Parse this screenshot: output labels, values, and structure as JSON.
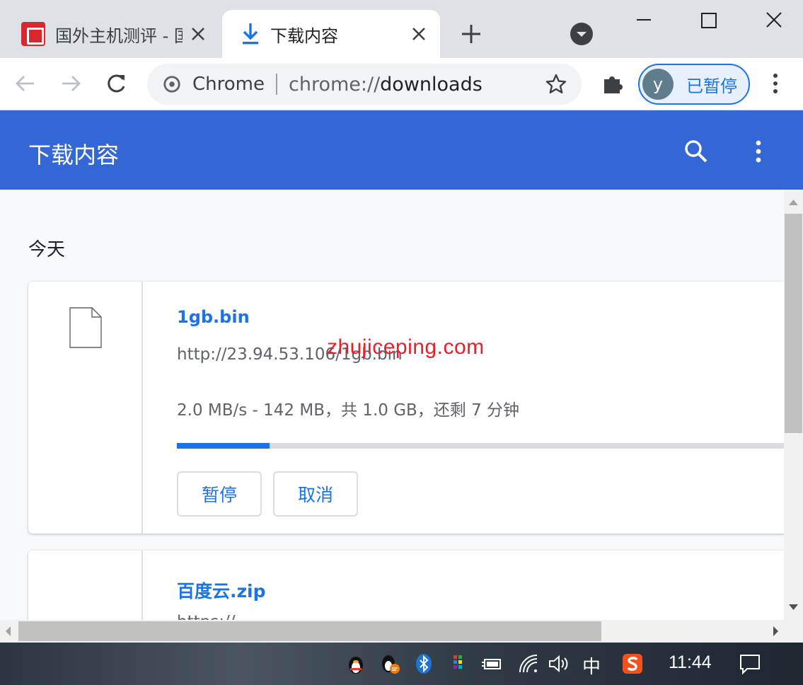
{
  "tabs": [
    {
      "title": "国外主机测评 - 国",
      "active": false
    },
    {
      "title": "下载内容",
      "active": true
    }
  ],
  "omnibox": {
    "site_label": "Chrome",
    "url_prefix": "chrome://",
    "url_path": "downloads"
  },
  "profile": {
    "initial": "y",
    "label": "已暂停"
  },
  "page": {
    "title": "下载内容"
  },
  "section": {
    "label": "今天"
  },
  "downloads": [
    {
      "name": "1gb.bin",
      "url": "http://23.94.53.106/1gb.bin",
      "status": "2.0 MB/s - 142 MB，共 1.0 GB，还剩 7 分钟",
      "progress": 0.15,
      "pause_label": "暂停",
      "cancel_label": "取消"
    },
    {
      "name": "百度云.zip",
      "url": "https://..."
    }
  ],
  "watermark": "zhujiceping.com",
  "taskbar": {
    "ime": "中",
    "clock": "11:44"
  },
  "colors": {
    "accent": "#1a73e8",
    "header": "#3367d6",
    "progress_track": "#dadce0"
  }
}
